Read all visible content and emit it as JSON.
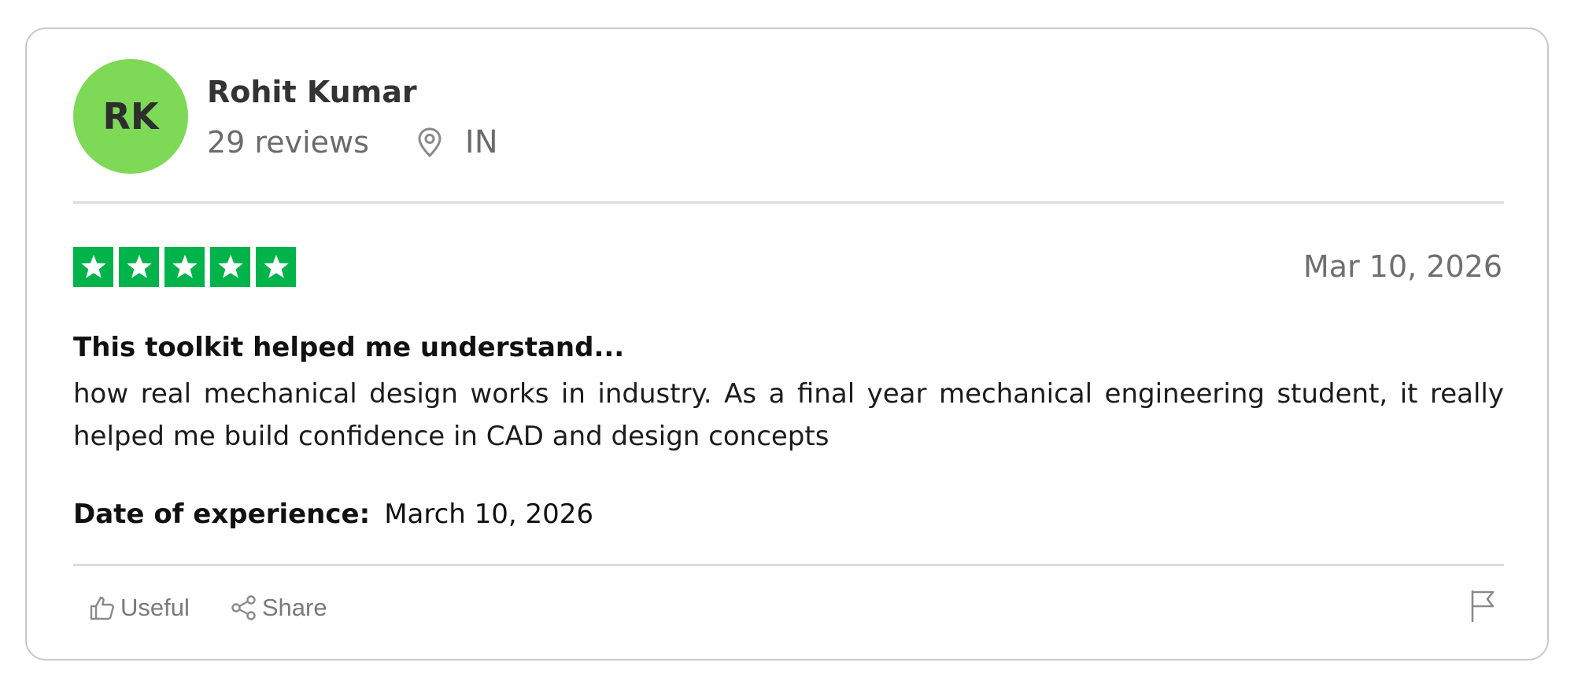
{
  "reviewer": {
    "initials": "RK",
    "name": "Rohit Kumar",
    "review_count": "29 reviews",
    "location": "IN",
    "avatar_color": "#7ed957"
  },
  "rating": {
    "stars": 5,
    "max_stars": 5,
    "star_color": "#00b34a"
  },
  "review": {
    "date": "Mar 10, 2026",
    "title": "This toolkit helped me understand...",
    "text": "how real mechanical design works in industry. As a final year mechanical engineering student, it really helped me build confidence in CAD and design concepts",
    "experience_label": "Date of experience:",
    "experience_date": "March 10, 2026"
  },
  "actions": {
    "useful_label": "Useful",
    "useful_icon": "thumbs-up-icon",
    "share_label": "Share",
    "share_icon": "share-icon",
    "report_icon": "flag-icon"
  }
}
